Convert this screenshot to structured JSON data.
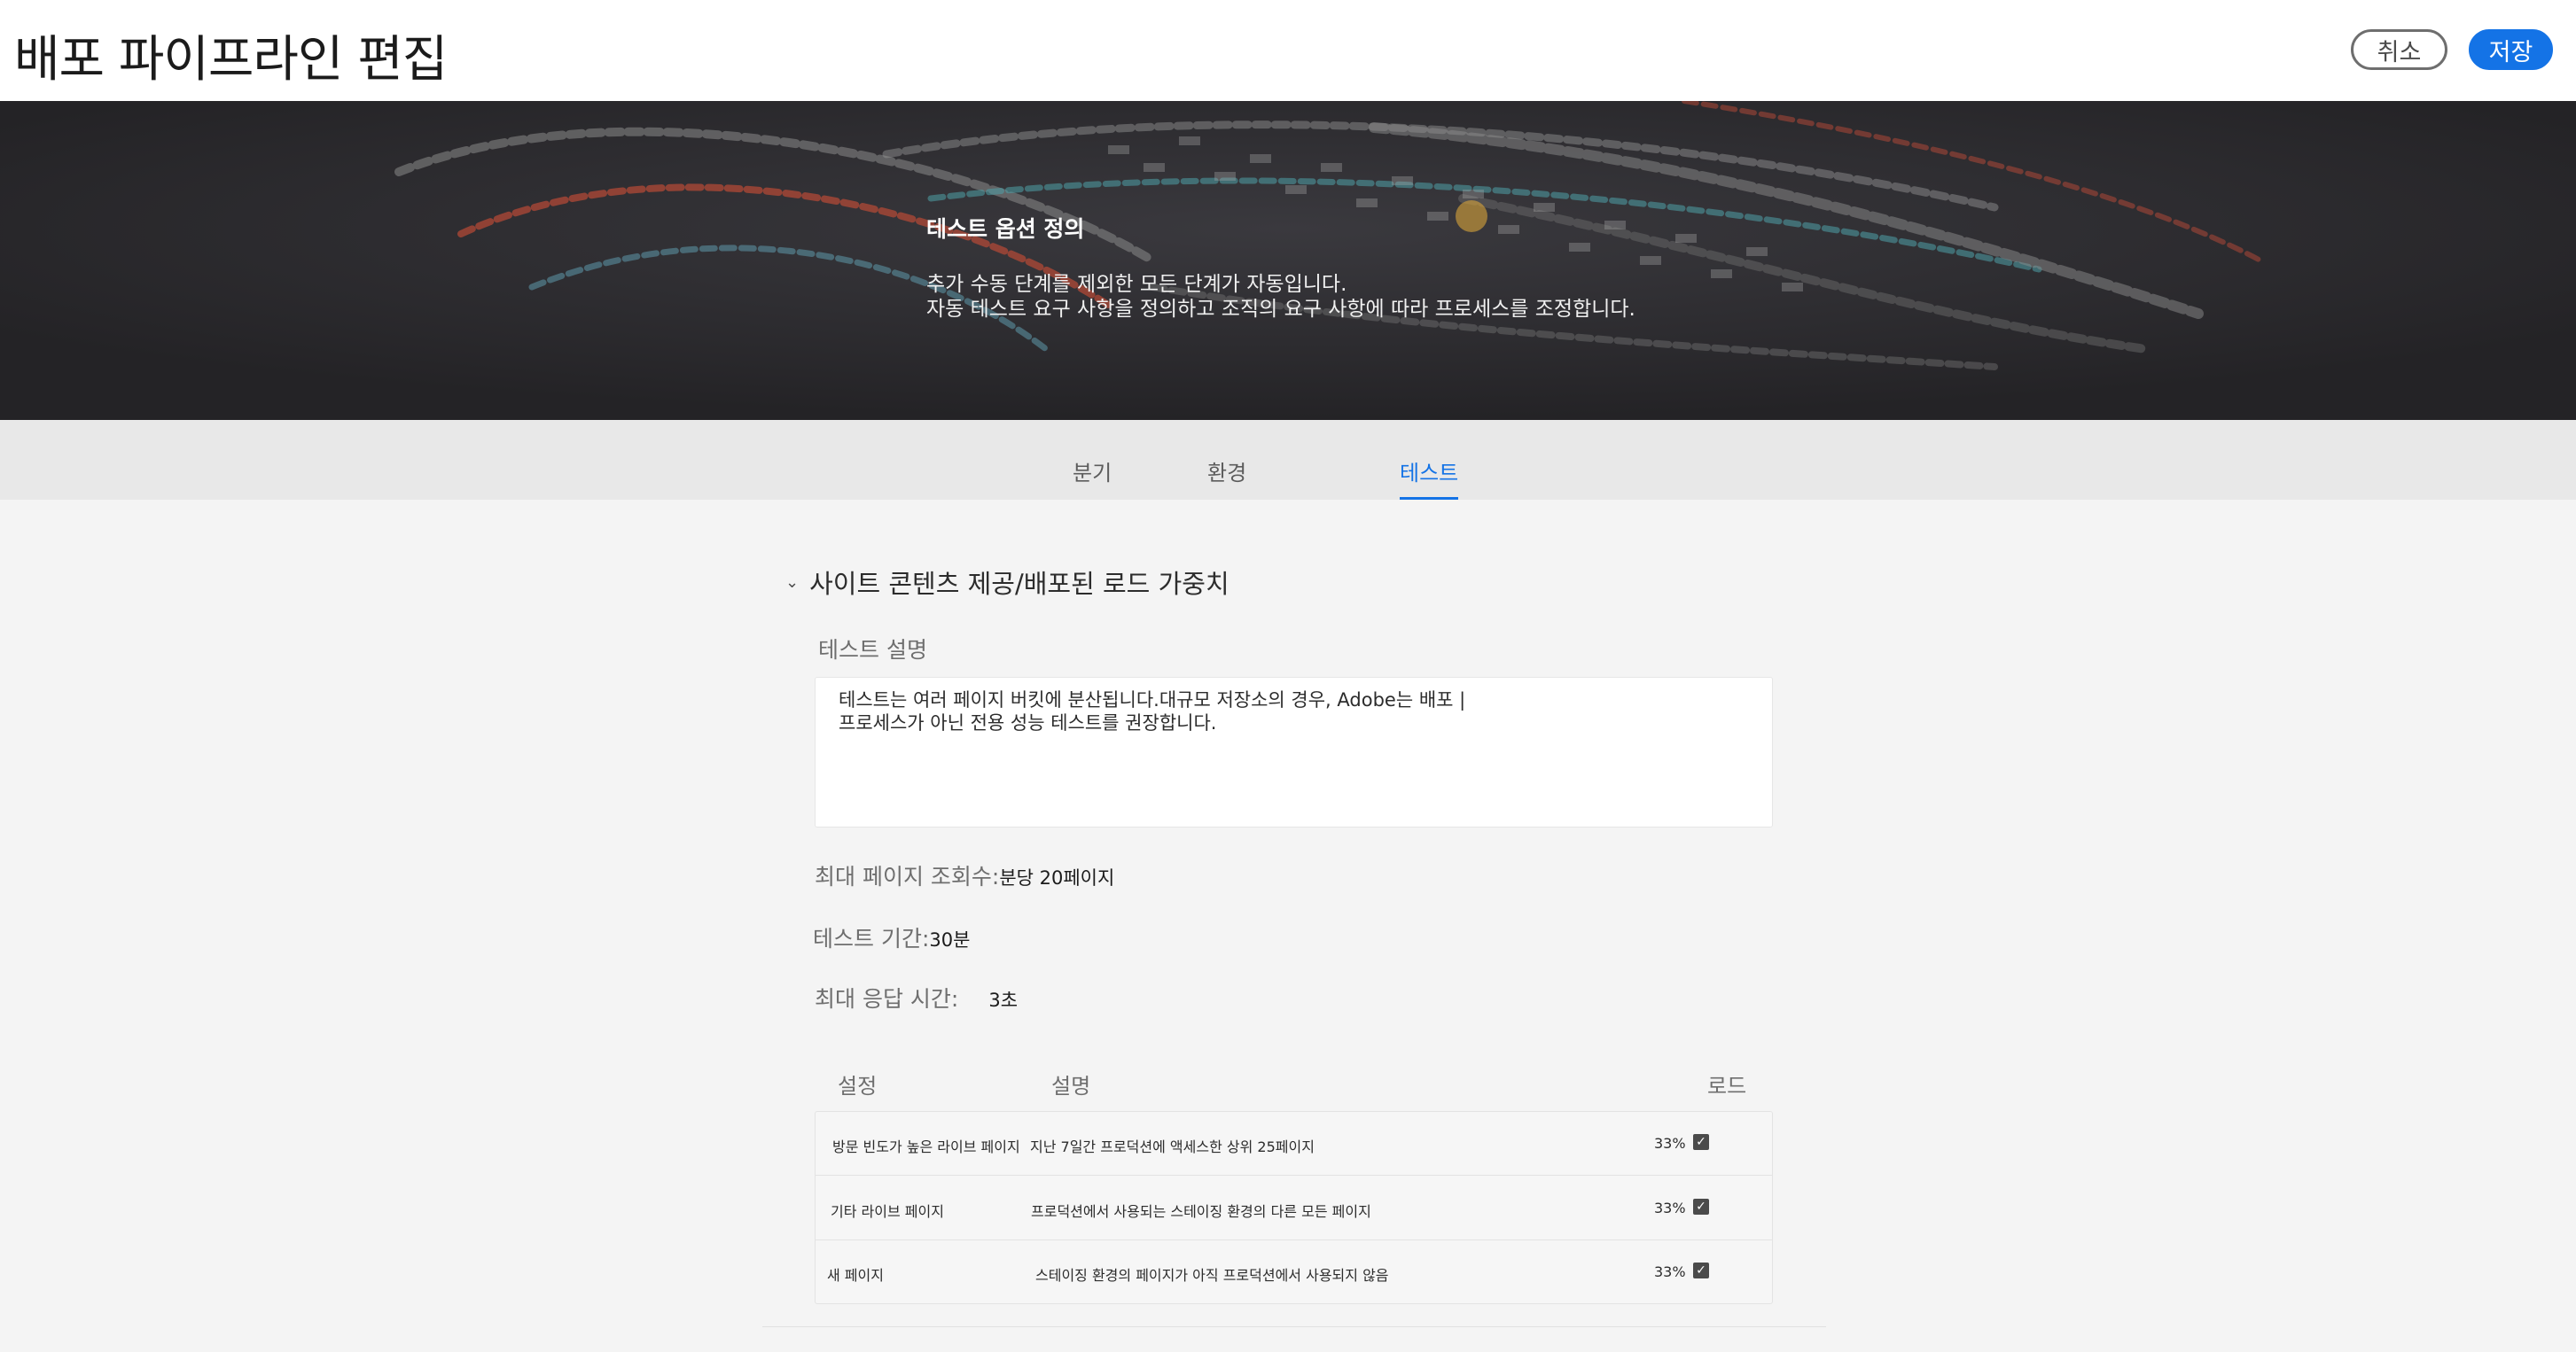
{
  "header": {
    "title": "배포 파이프라인 편집",
    "cancel_label": "취소",
    "save_label": "저장"
  },
  "banner": {
    "heading": "테스트 옵션 정의",
    "line1": "추가 수동 단계를 제외한 모든 단계가 자동입니다.",
    "line2": "자동 테스트 요구 사항을 정의하고 조직의 요구 사항에 따라 프로세스를 조정합니다."
  },
  "tabs": [
    {
      "label": "분기",
      "active": false
    },
    {
      "label": "환경",
      "active": false
    },
    {
      "label": "테스트",
      "active": true
    }
  ],
  "section": {
    "title": "사이트 콘텐츠 제공/배포된 로드 가중치",
    "description_label": "테스트 설명",
    "description_line1": "테스트는 여러 페이지 버킷에 분산됩니다.대규모 저장소의 경우, Adobe는 배포 |",
    "description_line2": "프로세스가 아닌 전용 성능 테스트를 권장합니다.",
    "max_pageviews_label": "최대 페이지 조회수:",
    "max_pageviews_value": "분당 20페이지",
    "duration_label": "테스트 기간:",
    "duration_value": "30분",
    "max_response_label": "최대 응답 시간:",
    "max_response_value": "3초"
  },
  "table": {
    "headers": {
      "setting": "설정",
      "description": "설명",
      "load": "로드"
    },
    "rows": [
      {
        "setting": "방문 빈도가 높은 라이브 페이지",
        "description": "지난 7일간 프로덕션에 액세스한 상위 25페이지",
        "load": "33%",
        "checked": true
      },
      {
        "setting": "기타 라이브 페이지",
        "description": "프로덕션에서 사용되는 스테이징 환경의 다른 모든 페이지",
        "load": "33%",
        "checked": true
      },
      {
        "setting": "새 페이지",
        "description": "스테이징 환경의 페이지가 아직 프로덕션에서 사용되지 않음",
        "load": "33%",
        "checked": true
      }
    ]
  },
  "colors": {
    "accent": "#1473e6",
    "banner_bg": "#29282b",
    "page_bg": "#f4f4f4"
  }
}
